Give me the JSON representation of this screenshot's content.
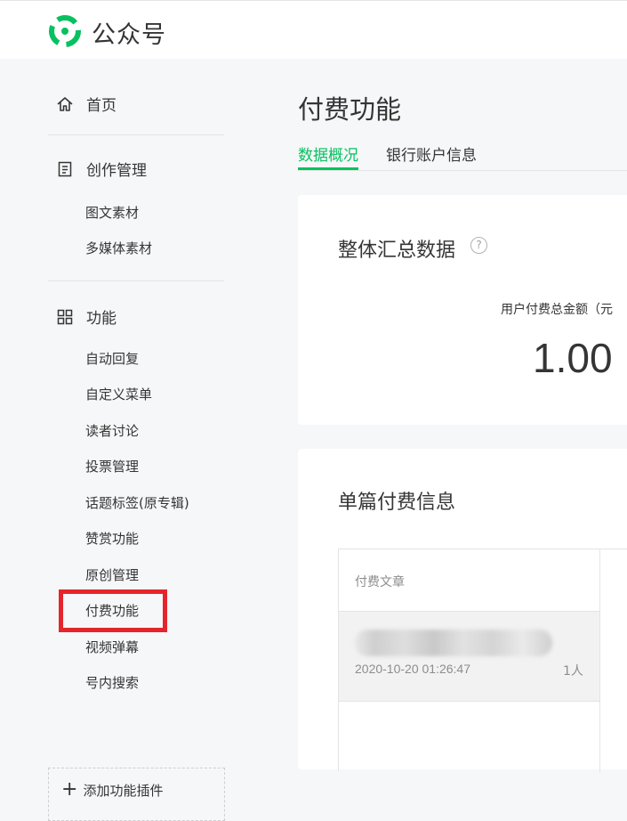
{
  "app": {
    "brand": "公众号",
    "brand_color": "#07c160"
  },
  "sidebar": {
    "home": {
      "icon": "home-icon",
      "label": "首页"
    },
    "sections": [
      {
        "icon": "document-icon",
        "label": "创作管理",
        "items": [
          "图文素材",
          "多媒体素材"
        ]
      },
      {
        "icon": "grid-icon",
        "label": "功能",
        "items": [
          "自动回复",
          "自定义菜单",
          "读者讨论",
          "投票管理",
          "话题标签(原专辑)",
          "赞赏功能",
          "原创管理",
          "付费功能",
          "视频弹幕",
          "号内搜索"
        ]
      }
    ],
    "highlighted_item": "付费功能",
    "highlight_color": "#e5252c",
    "add_plugin": {
      "icon": "plus-icon",
      "label": "添加功能插件"
    }
  },
  "main": {
    "page_title": "付费功能",
    "tabs": [
      {
        "label": "数据概况",
        "active": true
      },
      {
        "label": "银行账户信息",
        "active": false
      }
    ],
    "summary": {
      "title": "整体汇总数据",
      "help_icon": "question-icon",
      "metric_label": "用户付费总金额（元",
      "metric_value": "1.00"
    },
    "single": {
      "title": "单篇付费信息",
      "column_header": "付费文章",
      "rows": [
        {
          "date": "2020-10-20 01:26:47",
          "count": "1人"
        }
      ]
    }
  }
}
